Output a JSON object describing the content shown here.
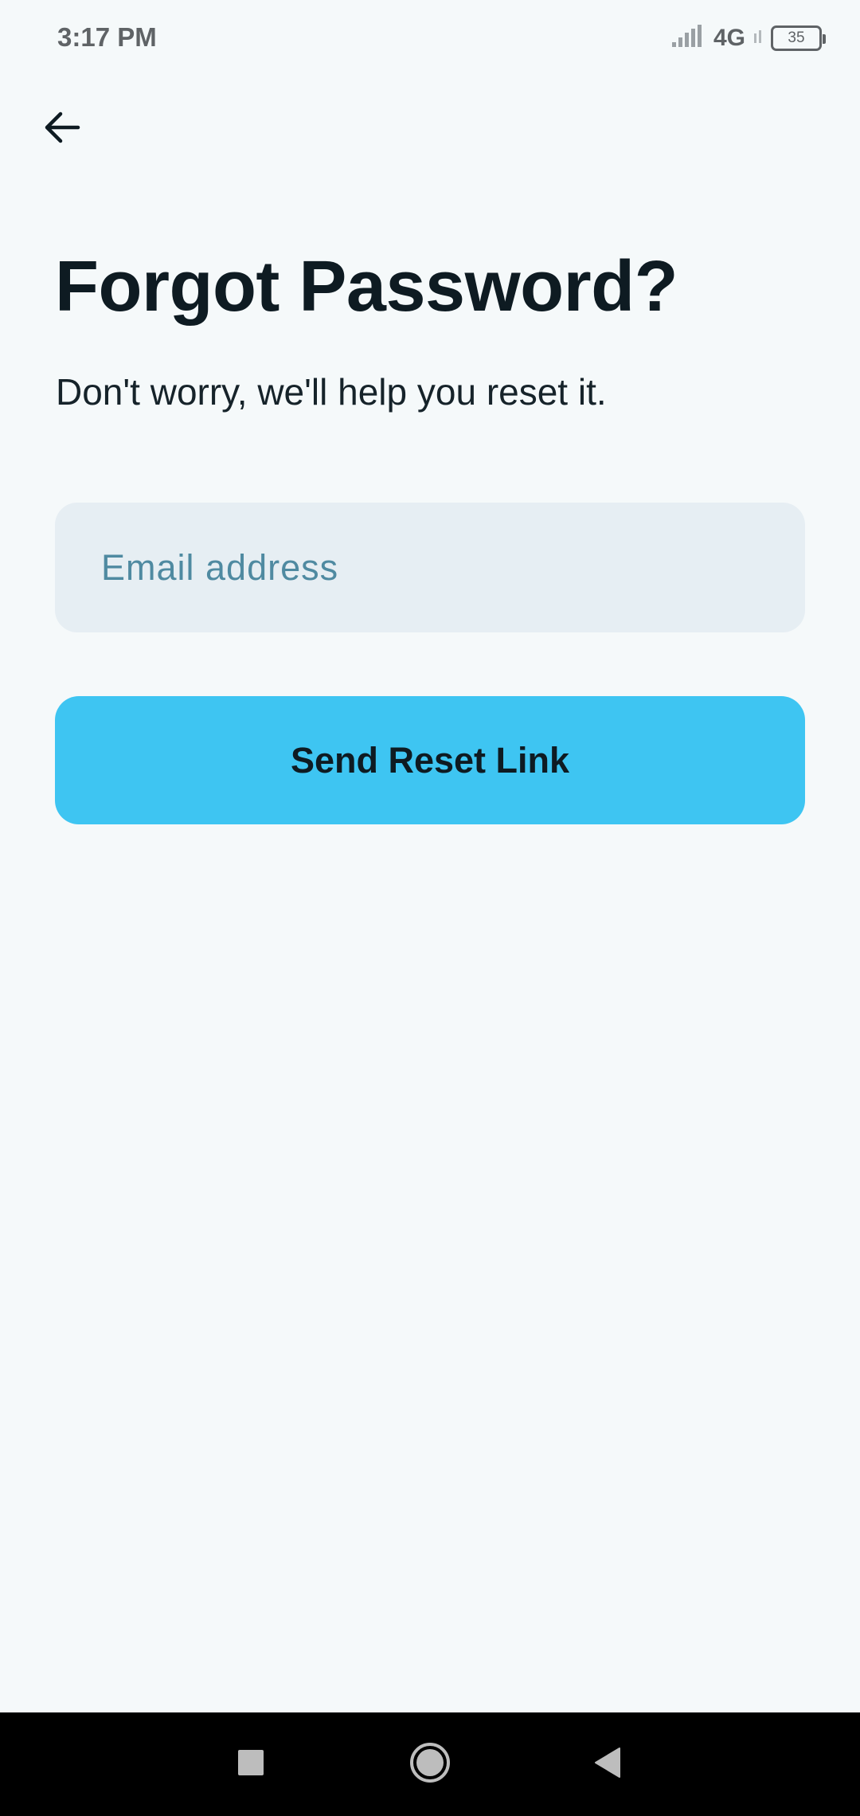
{
  "status_bar": {
    "time": "3:17 PM",
    "network": "4G",
    "battery": "35",
    "icons": [
      "signal-icon",
      "battery-icon"
    ]
  },
  "header": {
    "back_icon": "arrow-left-icon"
  },
  "main": {
    "title": "Forgot Password?",
    "subtitle": "Don't worry, we'll help you reset it.",
    "email_placeholder": "Email address",
    "email_value": "",
    "button_label": "Send Reset Link"
  },
  "nav_bar": {
    "icons": [
      "recents-square-icon",
      "home-circle-icon",
      "back-triangle-icon"
    ]
  },
  "colors": {
    "background": "#f5f9fa",
    "accent": "#3ec5f2",
    "input_bg": "#e6eef3",
    "placeholder": "#4f8aa1",
    "text": "#0e1b22"
  }
}
